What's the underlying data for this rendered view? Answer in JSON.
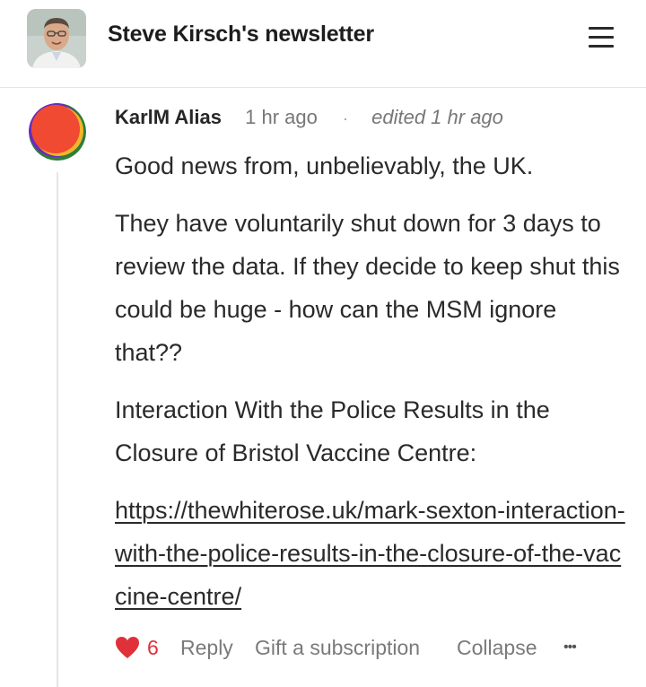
{
  "header": {
    "title": "Steve Kirsch's newsletter",
    "avatar_icon": "author-portrait",
    "menu_icon": "hamburger-menu-icon"
  },
  "comment": {
    "author": "KarlM Alias",
    "time": "1 hr ago",
    "separator": "·",
    "edited": "edited 1 hr ago",
    "paragraphs": [
      "Good news from, unbelievably, the UK.",
      "They have voluntarily shut down for 3 days to review the data. If they decide to keep shut this could be huge - how can the MSM ignore that??",
      "Interaction With the Police Results in the Closure of Bristol Vaccine Centre:"
    ],
    "link": "https://thewhiterose.uk/mark-sexton-interaction-with-the-police-results-in-the-closure-of-the-vaccine-centre/",
    "actions": {
      "like_count": "6",
      "reply": "Reply",
      "gift": "Gift a subscription",
      "collapse": "Collapse",
      "more": "•••"
    }
  },
  "colors": {
    "heart": "#e0303a",
    "muted_text": "#777777",
    "body_text": "#2a2a2a"
  }
}
